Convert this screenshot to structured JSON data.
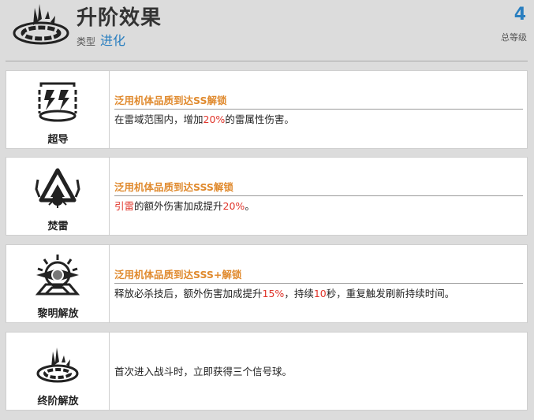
{
  "header": {
    "title": "升阶效果",
    "type_label": "类型",
    "type_value": "进化",
    "level_value": "4",
    "level_label": "总等级",
    "icon": "evolution-ring-icon"
  },
  "colors": {
    "accent_blue": "#2a7fc0",
    "condition_orange": "#e08a2e",
    "highlight_red": "#e0352b"
  },
  "effects": [
    {
      "name": "超导",
      "icon": "lightning-cylinder-icon",
      "condition": "泛用机体品质到达SS解锁",
      "desc": {
        "pre": "在雷域范围内，增加",
        "hl": "20%",
        "post": "的雷属性伤害。"
      }
    },
    {
      "name": "焚雷",
      "icon": "spiked-triangle-icon",
      "condition": "泛用机体品质到达SSS解锁",
      "desc": {
        "hl1": "引雷",
        "mid": "的额外伤害加成提升",
        "hl2": "20%",
        "post": "。"
      }
    },
    {
      "name": "黎明解放",
      "icon": "radiant-eye-icon",
      "condition": "泛用机体品质到达SSS+解锁",
      "desc": {
        "pre": "释放必杀技后，额外伤害加成提升",
        "hl1": "15%",
        "mid": "，持续",
        "hl2": "10",
        "post": "秒，重复触发刷新持续时间。"
      }
    },
    {
      "name": "终阶解放",
      "icon": "evolution-ring-icon",
      "desc": {
        "text": "首次进入战斗时，立即获得三个信号球。"
      }
    }
  ]
}
